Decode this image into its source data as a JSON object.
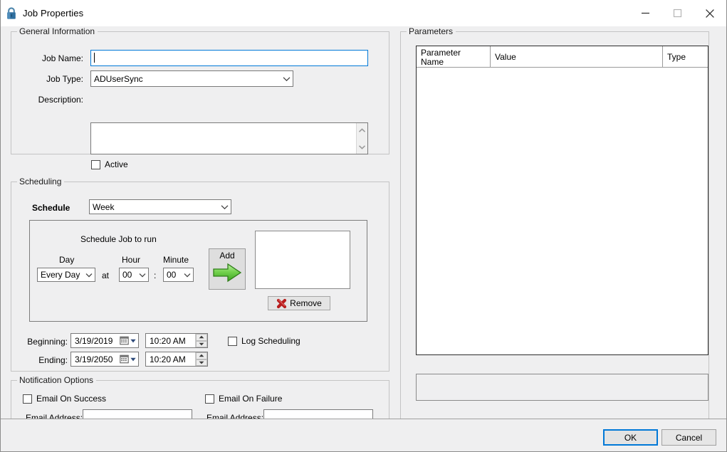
{
  "window": {
    "title": "Job Properties",
    "icon": "lock-icon",
    "controls": {
      "minimize": "minimize-icon",
      "maximize": "maximize-icon",
      "close": "close-icon"
    }
  },
  "general": {
    "group_title": "General Information",
    "job_name_label": "Job Name:",
    "job_name_value": "",
    "job_name_placeholder": "",
    "job_type_label": "Job Type:",
    "job_type_value": "ADUserSync",
    "job_type_options": [
      "ADUserSync"
    ],
    "description_label": "Description:",
    "description_value": "",
    "active_label": "Active",
    "active_checked": false
  },
  "scheduling": {
    "group_title": "Scheduling",
    "schedule_label": "Schedule",
    "schedule_value": "Week",
    "schedule_options": [
      "Week"
    ],
    "inner": {
      "heading": "Schedule Job to run",
      "day_label": "Day",
      "hour_label": "Hour",
      "minute_label": "Minute",
      "day_value": "Every Day",
      "day_options": [
        "Every Day"
      ],
      "at_label": "at",
      "hour_value": "00",
      "minute_value": "00",
      "time_separator": ":",
      "add_label": "Add",
      "add_icon": "green-right-arrow-icon",
      "remove_label": "Remove",
      "remove_icon": "red-x-icon",
      "schedule_list_items": []
    },
    "beginning_label": "Beginning:",
    "beginning_date": "3/19/2019",
    "beginning_time": "10:20 AM",
    "ending_label": "Ending:",
    "ending_date": "3/19/2050",
    "ending_time": "10:20 AM",
    "log_scheduling_label": "Log Scheduling",
    "log_scheduling_checked": false
  },
  "notifications": {
    "group_title": "Notification Options",
    "success": {
      "checkbox_label": "Email On Success",
      "checked": false,
      "email_label": "Email Address:",
      "email_value": ""
    },
    "failure": {
      "checkbox_label": "Email On Failure",
      "checked": false,
      "email_label": "Email Address:",
      "email_value": ""
    }
  },
  "parameters": {
    "group_title": "Parameters",
    "columns": [
      "Parameter Name",
      "Value",
      "Type"
    ],
    "column_header_line1": "Parameter",
    "column_header_line2": "Name",
    "column_value": "Value",
    "column_type": "Type",
    "rows": [],
    "description_value": ""
  },
  "footer": {
    "ok_label": "OK",
    "cancel_label": "Cancel"
  },
  "colors": {
    "dialog_bg": "#efeff0",
    "accent_focus": "#0078d7",
    "arrow_green": "#56c03a",
    "x_red": "#b81d1d",
    "lock_blue": "#2f6f9f"
  }
}
